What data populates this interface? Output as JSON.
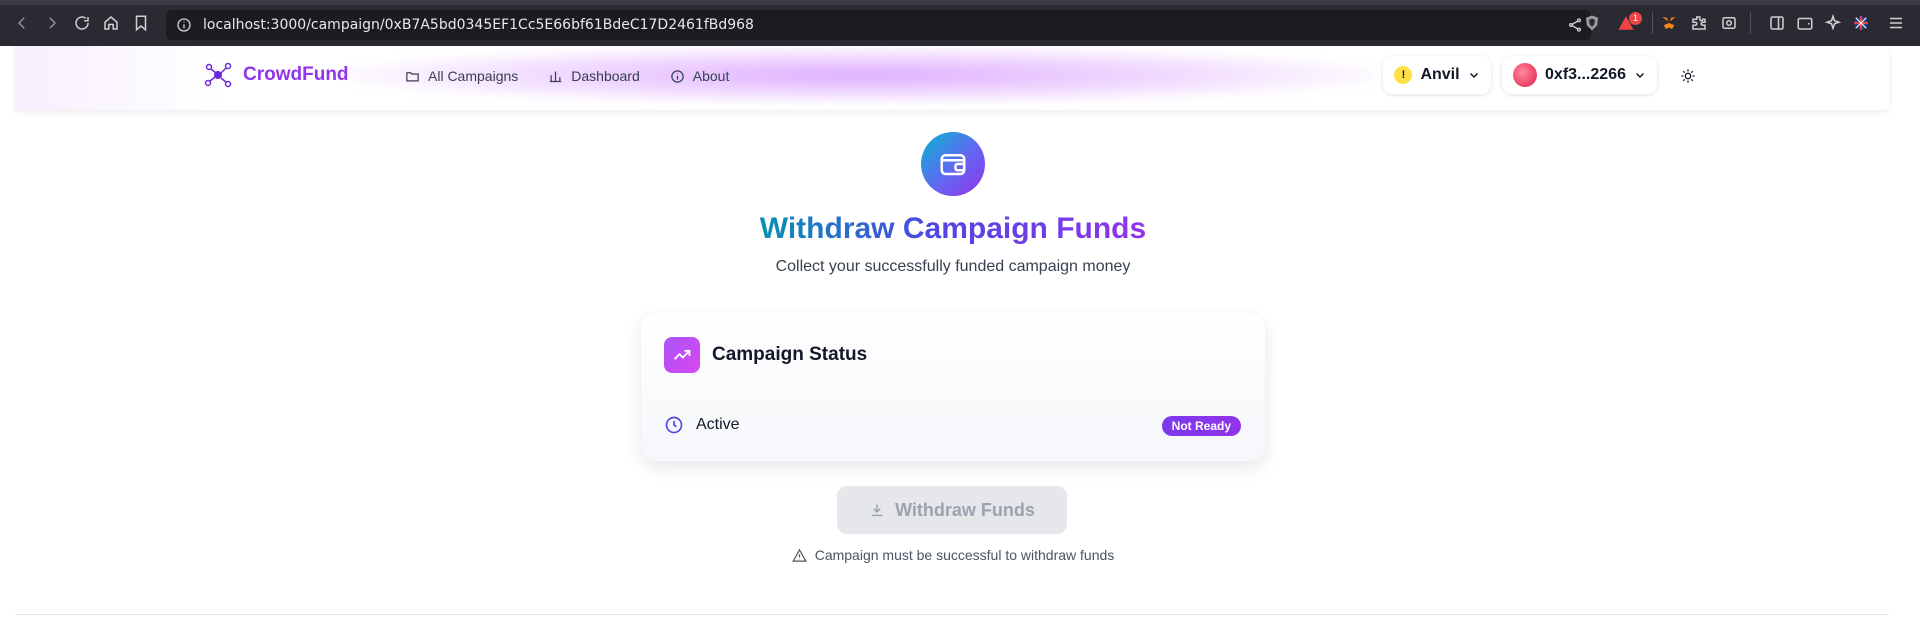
{
  "browser": {
    "url": "localhost:3000/campaign/0xB7A5bd0345EF1Cc5E66bf61BdeC17D2461fBd968",
    "notification_count": "1"
  },
  "header": {
    "brand": "CrowdFund",
    "nav": [
      {
        "label": "All Campaigns",
        "icon": "folder-icon"
      },
      {
        "label": "Dashboard",
        "icon": "bar-chart-icon"
      },
      {
        "label": "About",
        "icon": "info-icon"
      }
    ],
    "network_label": "Anvil",
    "account_label": "0xf3...2266"
  },
  "main": {
    "title": "Withdraw Campaign Funds",
    "subtitle": "Collect your successfully funded campaign money",
    "card": {
      "title": "Campaign Status",
      "status": "Active",
      "badge": "Not Ready"
    },
    "withdraw_button": "Withdraw Funds",
    "warning": "Campaign must be successful to withdraw funds"
  },
  "colors": {
    "brand": "#9333ea",
    "accent": "#7c3aed",
    "cyan": "#0891b2"
  }
}
